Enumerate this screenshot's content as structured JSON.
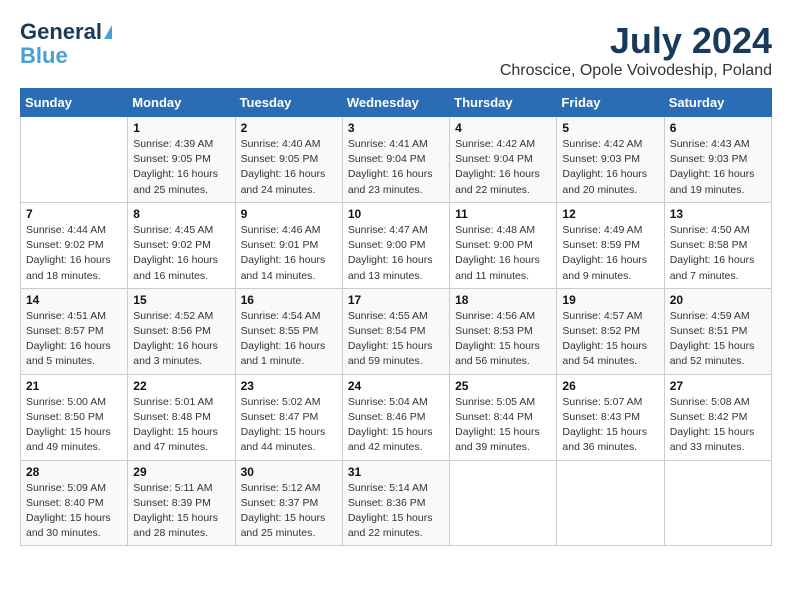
{
  "header": {
    "logo_line1": "General",
    "logo_line2": "Blue",
    "month_year": "July 2024",
    "location": "Chroscice, Opole Voivodeship, Poland"
  },
  "days_of_week": [
    "Sunday",
    "Monday",
    "Tuesday",
    "Wednesday",
    "Thursday",
    "Friday",
    "Saturday"
  ],
  "weeks": [
    [
      {
        "day": "",
        "info": ""
      },
      {
        "day": "1",
        "info": "Sunrise: 4:39 AM\nSunset: 9:05 PM\nDaylight: 16 hours\nand 25 minutes."
      },
      {
        "day": "2",
        "info": "Sunrise: 4:40 AM\nSunset: 9:05 PM\nDaylight: 16 hours\nand 24 minutes."
      },
      {
        "day": "3",
        "info": "Sunrise: 4:41 AM\nSunset: 9:04 PM\nDaylight: 16 hours\nand 23 minutes."
      },
      {
        "day": "4",
        "info": "Sunrise: 4:42 AM\nSunset: 9:04 PM\nDaylight: 16 hours\nand 22 minutes."
      },
      {
        "day": "5",
        "info": "Sunrise: 4:42 AM\nSunset: 9:03 PM\nDaylight: 16 hours\nand 20 minutes."
      },
      {
        "day": "6",
        "info": "Sunrise: 4:43 AM\nSunset: 9:03 PM\nDaylight: 16 hours\nand 19 minutes."
      }
    ],
    [
      {
        "day": "7",
        "info": "Sunrise: 4:44 AM\nSunset: 9:02 PM\nDaylight: 16 hours\nand 18 minutes."
      },
      {
        "day": "8",
        "info": "Sunrise: 4:45 AM\nSunset: 9:02 PM\nDaylight: 16 hours\nand 16 minutes."
      },
      {
        "day": "9",
        "info": "Sunrise: 4:46 AM\nSunset: 9:01 PM\nDaylight: 16 hours\nand 14 minutes."
      },
      {
        "day": "10",
        "info": "Sunrise: 4:47 AM\nSunset: 9:00 PM\nDaylight: 16 hours\nand 13 minutes."
      },
      {
        "day": "11",
        "info": "Sunrise: 4:48 AM\nSunset: 9:00 PM\nDaylight: 16 hours\nand 11 minutes."
      },
      {
        "day": "12",
        "info": "Sunrise: 4:49 AM\nSunset: 8:59 PM\nDaylight: 16 hours\nand 9 minutes."
      },
      {
        "day": "13",
        "info": "Sunrise: 4:50 AM\nSunset: 8:58 PM\nDaylight: 16 hours\nand 7 minutes."
      }
    ],
    [
      {
        "day": "14",
        "info": "Sunrise: 4:51 AM\nSunset: 8:57 PM\nDaylight: 16 hours\nand 5 minutes."
      },
      {
        "day": "15",
        "info": "Sunrise: 4:52 AM\nSunset: 8:56 PM\nDaylight: 16 hours\nand 3 minutes."
      },
      {
        "day": "16",
        "info": "Sunrise: 4:54 AM\nSunset: 8:55 PM\nDaylight: 16 hours\nand 1 minute."
      },
      {
        "day": "17",
        "info": "Sunrise: 4:55 AM\nSunset: 8:54 PM\nDaylight: 15 hours\nand 59 minutes."
      },
      {
        "day": "18",
        "info": "Sunrise: 4:56 AM\nSunset: 8:53 PM\nDaylight: 15 hours\nand 56 minutes."
      },
      {
        "day": "19",
        "info": "Sunrise: 4:57 AM\nSunset: 8:52 PM\nDaylight: 15 hours\nand 54 minutes."
      },
      {
        "day": "20",
        "info": "Sunrise: 4:59 AM\nSunset: 8:51 PM\nDaylight: 15 hours\nand 52 minutes."
      }
    ],
    [
      {
        "day": "21",
        "info": "Sunrise: 5:00 AM\nSunset: 8:50 PM\nDaylight: 15 hours\nand 49 minutes."
      },
      {
        "day": "22",
        "info": "Sunrise: 5:01 AM\nSunset: 8:48 PM\nDaylight: 15 hours\nand 47 minutes."
      },
      {
        "day": "23",
        "info": "Sunrise: 5:02 AM\nSunset: 8:47 PM\nDaylight: 15 hours\nand 44 minutes."
      },
      {
        "day": "24",
        "info": "Sunrise: 5:04 AM\nSunset: 8:46 PM\nDaylight: 15 hours\nand 42 minutes."
      },
      {
        "day": "25",
        "info": "Sunrise: 5:05 AM\nSunset: 8:44 PM\nDaylight: 15 hours\nand 39 minutes."
      },
      {
        "day": "26",
        "info": "Sunrise: 5:07 AM\nSunset: 8:43 PM\nDaylight: 15 hours\nand 36 minutes."
      },
      {
        "day": "27",
        "info": "Sunrise: 5:08 AM\nSunset: 8:42 PM\nDaylight: 15 hours\nand 33 minutes."
      }
    ],
    [
      {
        "day": "28",
        "info": "Sunrise: 5:09 AM\nSunset: 8:40 PM\nDaylight: 15 hours\nand 30 minutes."
      },
      {
        "day": "29",
        "info": "Sunrise: 5:11 AM\nSunset: 8:39 PM\nDaylight: 15 hours\nand 28 minutes."
      },
      {
        "day": "30",
        "info": "Sunrise: 5:12 AM\nSunset: 8:37 PM\nDaylight: 15 hours\nand 25 minutes."
      },
      {
        "day": "31",
        "info": "Sunrise: 5:14 AM\nSunset: 8:36 PM\nDaylight: 15 hours\nand 22 minutes."
      },
      {
        "day": "",
        "info": ""
      },
      {
        "day": "",
        "info": ""
      },
      {
        "day": "",
        "info": ""
      }
    ]
  ]
}
